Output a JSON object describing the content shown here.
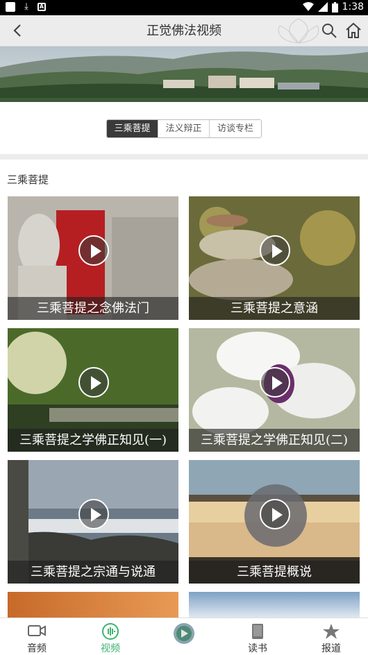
{
  "status": {
    "time": "1:38"
  },
  "header": {
    "title": "正觉佛法视频"
  },
  "tabs": [
    {
      "label": "三乘菩提",
      "active": true
    },
    {
      "label": "法义辩正",
      "active": false
    },
    {
      "label": "访谈专栏",
      "active": false
    }
  ],
  "section": {
    "title": "三乘菩提"
  },
  "videos": [
    {
      "caption": "三乘菩提之念佛法门"
    },
    {
      "caption": "三乘菩提之意涵"
    },
    {
      "caption": "三乘菩提之学佛正知见(一)"
    },
    {
      "caption": "三乘菩提之学佛正知见(二)"
    },
    {
      "caption": "三乘菩提之宗通与说通"
    },
    {
      "caption": "三乘菩提概说"
    }
  ],
  "nav": [
    {
      "label": "音频",
      "icon": "video-camera-icon"
    },
    {
      "label": "视频",
      "icon": "soundwave-icon",
      "active": true
    },
    {
      "label": "",
      "icon": "center-logo-icon"
    },
    {
      "label": "读书",
      "icon": "book-icon"
    },
    {
      "label": "报道",
      "icon": "star-icon"
    }
  ],
  "colors": {
    "accent": "#3cb371",
    "activeTab": "#3a3a3a"
  }
}
